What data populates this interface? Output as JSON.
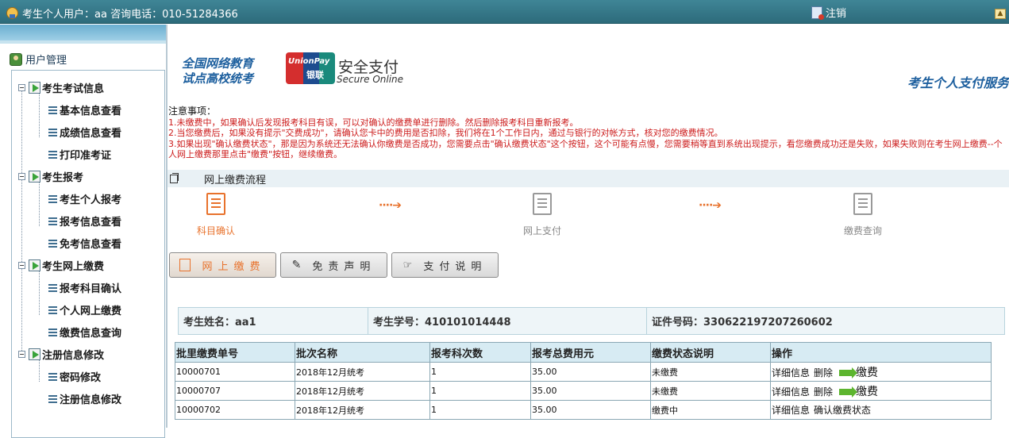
{
  "topbar": {
    "user_text": "考生个人用户：aa 咨询电话：010-51284366",
    "logout_label": "注销"
  },
  "sidebar": {
    "header": "用户管理",
    "groups": [
      {
        "label": "考生考试信息",
        "items": [
          {
            "label": "基本信息查看"
          },
          {
            "label": "成绩信息查看"
          },
          {
            "label": "打印准考证"
          }
        ]
      },
      {
        "label": "考生报考",
        "items": [
          {
            "label": "考生个人报考"
          },
          {
            "label": "报考信息查看"
          },
          {
            "label": "免考信息查看"
          }
        ]
      },
      {
        "label": "考生网上缴费",
        "items": [
          {
            "label": "报考科目确认"
          },
          {
            "label": "个人网上缴费"
          },
          {
            "label": "缴费信息查询"
          }
        ]
      },
      {
        "label": "注册信息修改",
        "items": [
          {
            "label": "密码修改"
          },
          {
            "label": "注册信息修改"
          }
        ]
      }
    ]
  },
  "banner": {
    "left_line1": "全国网络教育",
    "left_line2": "试点高校统考",
    "unionpay_en": "UnionPay",
    "unionpay_cn": "银联",
    "secure_cn": "安全支付",
    "secure_en": "Secure Online",
    "right_title": "考生个人支付服务"
  },
  "notice": {
    "title": "注意事项：",
    "lines": [
      "1.未缴费中，如果确认后发现报考科目有误，可以对确认的缴费单进行删除。然后删除报考科目重新报考。",
      "2.当您缴费后，如果没有提示\"交费成功\"，请确认您卡中的费用是否扣除，我们将在1个工作日内，通过与银行的对帐方式，核对您的缴费情况。",
      "3.如果出现\"确认缴费状态\"，那是因为系统还无法确认你缴费是否成功，您需要点击\"确认缴费状态\"这个按钮，这个可能有点慢，您需要稍等直到系统出现提示，看您缴费成功还是失败，如果失败则在考生网上缴费--个人网上缴费那里点击\"缴费\"按钮，继续缴费。"
    ]
  },
  "flow": {
    "title": "网上缴费流程",
    "steps": [
      {
        "label": "科目确认"
      },
      {
        "label": "网上支付"
      },
      {
        "label": "缴费查询"
      }
    ],
    "arrow": "····➔"
  },
  "tabs": {
    "pay": "网上缴费",
    "disclaimer": "免责声明",
    "instructions": "支付说明"
  },
  "student": {
    "name": "考生姓名：aa1",
    "number": "考生学号：410101014448",
    "id_number": "证件号码：330622197207260602"
  },
  "table": {
    "headers": [
      "批里缴费单号",
      "批次名称",
      "报考科次数",
      "报考总费用元",
      "缴费状态说明",
      "操作"
    ],
    "rows": [
      {
        "order_no": "10000701",
        "batch": "2018年12月统考",
        "count": "1",
        "total": "35.00",
        "status": "未缴费",
        "op_detail": "详细信息",
        "op_delete": "删除",
        "op_pay": "缴费"
      },
      {
        "order_no": "10000707",
        "batch": "2018年12月统考",
        "count": "1",
        "total": "35.00",
        "status": "未缴费",
        "op_detail": "详细信息",
        "op_delete": "删除",
        "op_pay": "缴费"
      },
      {
        "order_no": "10000702",
        "batch": "2018年12月统考",
        "count": "1",
        "total": "35.00",
        "status": "缴费中",
        "op_detail": "详细信息",
        "op_confirm": "确认缴费状态"
      }
    ]
  },
  "colors": {
    "topbar": "#2d6b7b",
    "accent_orange": "#e8722c",
    "notice_red": "#cc1b1b",
    "table_header": "#d7ebf3",
    "pay_arrow": "#5db52f"
  }
}
